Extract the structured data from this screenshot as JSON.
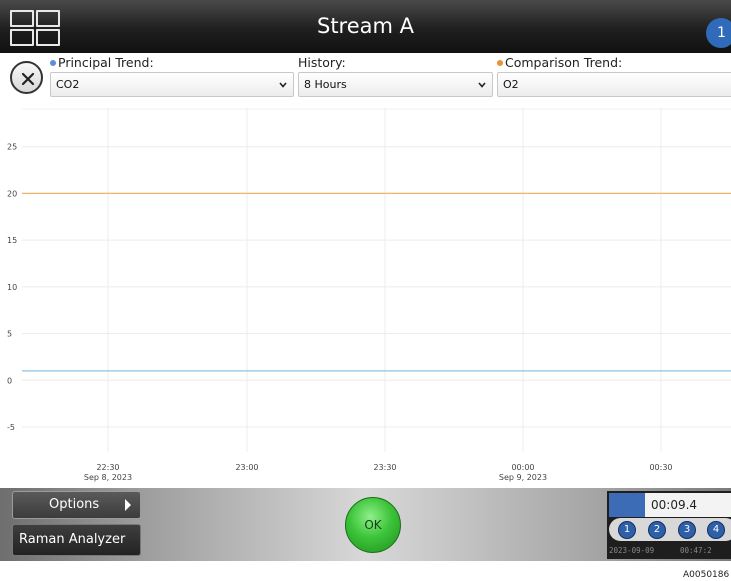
{
  "header": {
    "title": "Stream A",
    "notification_count": "1"
  },
  "controls": {
    "principal_trend": {
      "label": "Principal Trend:",
      "value": "CO2",
      "color": "#5b8fd8"
    },
    "history": {
      "label": "History:",
      "value": "8 Hours"
    },
    "comparison_trend": {
      "label": "Comparison Trend:",
      "value": "O2",
      "color": "#e8923a"
    }
  },
  "chart_data": {
    "type": "line",
    "ylim": [
      -8,
      30
    ],
    "y_ticks": [
      "25",
      "20",
      "15",
      "10",
      "5",
      "0",
      "-5"
    ],
    "x_ticks": [
      {
        "time": "22:30",
        "date": "Sep 8, 2023"
      },
      {
        "time": "23:00",
        "date": ""
      },
      {
        "time": "23:30",
        "date": ""
      },
      {
        "time": "00:00",
        "date": "Sep 9, 2023"
      },
      {
        "time": "00:30",
        "date": ""
      }
    ],
    "grid": true,
    "series": [
      {
        "color": "#f2b36b",
        "values": [
          20,
          20,
          20,
          20,
          20
        ]
      },
      {
        "color": "#8cc3e6",
        "values": [
          1,
          1,
          1,
          1,
          1
        ]
      }
    ]
  },
  "footer": {
    "options_label": "Options",
    "analyzer_label": "Raman Analyzer",
    "ok_label": "OK",
    "progress_time": "00:09.4",
    "progress_fraction": 0.29,
    "steps": [
      "1",
      "2",
      "3",
      "4"
    ],
    "stamp_date": "2023-09-09",
    "stamp_time": "00:47:2"
  },
  "doc_code": "A0050186"
}
